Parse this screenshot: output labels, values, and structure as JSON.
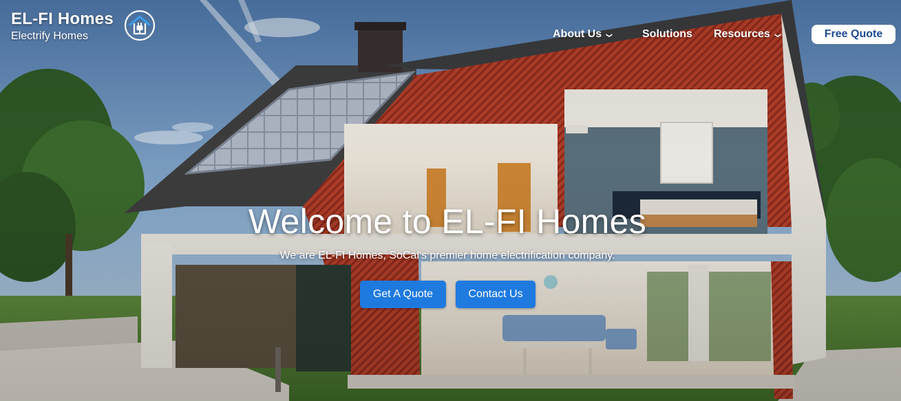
{
  "brand": {
    "title": "EL-FI Homes",
    "subtitle": "Electrify Homes",
    "logo_icon": "house-plug-icon"
  },
  "nav": {
    "items": [
      {
        "label": "About Us",
        "has_dropdown": true
      },
      {
        "label": "Solutions",
        "has_dropdown": false
      },
      {
        "label": "Resources",
        "has_dropdown": true
      }
    ],
    "cta_label": "Free Quote"
  },
  "hero": {
    "title": "Welcome to EL-FI Homes",
    "subtitle": "We are EL-FI Homes, SoCal's premier home electrification company.",
    "buttons": [
      {
        "label": "Get A Quote"
      },
      {
        "label": "Contact Us"
      }
    ],
    "background": "cutaway-house-with-solar-panels-image"
  },
  "colors": {
    "primary_button": "#1f7ae0",
    "quote_text": "#1d4b8f",
    "wall_brick": "#b8412c",
    "roof": "#4a4a4a",
    "sky": "#6a8fb8",
    "grass": "#4f7d35"
  }
}
